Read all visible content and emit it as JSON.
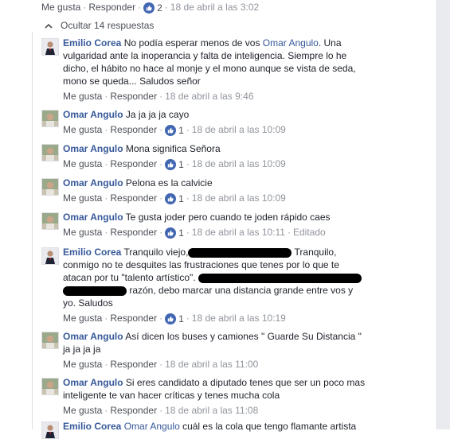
{
  "top_actions": {
    "like": "Me gusta",
    "reply": "Responder",
    "likes": "2",
    "time": "18 de abril a las 3:02"
  },
  "toggle": {
    "label": "Ocultar 14 respuestas"
  },
  "colors": {
    "link": "#365899",
    "like_badge": "#4267b2",
    "meta": "#90949c"
  },
  "comments": [
    {
      "avatar": "emilio-avatar",
      "author": "Emilio Corea",
      "segments": [
        {
          "type": "text",
          "value": " No podía esperar menos de vos "
        },
        {
          "type": "mention",
          "value": "Omar Angulo"
        },
        {
          "type": "text",
          "value": ". Una vulgaridad ante la inoperancia y falta de inteligencia. Siempre lo he dicho, el hábito no hace al monje y el mono aunque se vista de seda, mono se queda... Saludos señor"
        }
      ],
      "like": "Me gusta",
      "reply": "Responder",
      "likes": null,
      "time": "18 de abril a las 9:46",
      "edited": null
    },
    {
      "avatar": "omar-avatar",
      "author": "Omar Angulo",
      "segments": [
        {
          "type": "text",
          "value": " Ja ja ja ja cayo"
        }
      ],
      "like": "Me gusta",
      "reply": "Responder",
      "likes": "1",
      "time": "18 de abril a las 10:09",
      "edited": null
    },
    {
      "avatar": "omar-avatar",
      "author": "Omar Angulo",
      "segments": [
        {
          "type": "text",
          "value": " Mona significa Señora"
        }
      ],
      "like": "Me gusta",
      "reply": "Responder",
      "likes": "1",
      "time": "18 de abril a las 10:09",
      "edited": null
    },
    {
      "avatar": "omar-avatar",
      "author": "Omar Angulo",
      "segments": [
        {
          "type": "text",
          "value": " Pelona es la calvicie"
        }
      ],
      "like": "Me gusta",
      "reply": "Responder",
      "likes": "1",
      "time": "18 de abril a las 10:09",
      "edited": null
    },
    {
      "avatar": "omar-avatar",
      "author": "Omar Angulo",
      "segments": [
        {
          "type": "text",
          "value": " Te gusta joder pero cuando te joden rápido caes"
        }
      ],
      "like": "Me gusta",
      "reply": "Responder",
      "likes": "1",
      "time": "18 de abril a las 10:11",
      "edited": "Editado"
    },
    {
      "avatar": "emilio-avatar",
      "author": "Emilio Corea",
      "segments": [
        {
          "type": "text",
          "value": " Tranquilo viejo,"
        },
        {
          "type": "redact",
          "value": "130"
        },
        {
          "type": "text",
          "value": " Tranquilo, conmigo no te desquites las frustraciones que tenes por lo que te atacan por tu \"talento artístico\". "
        },
        {
          "type": "redact",
          "value": "205"
        },
        {
          "type": "text",
          "value": " "
        },
        {
          "type": "redact",
          "value": "80"
        },
        {
          "type": "text",
          "value": " razón, debo marcar una distancia grande entre vos y yo. Saludos"
        }
      ],
      "like": "Me gusta",
      "reply": "Responder",
      "likes": "1",
      "time": "18 de abril a las 10:19",
      "edited": null
    },
    {
      "avatar": "omar-avatar",
      "author": "Omar Angulo",
      "segments": [
        {
          "type": "text",
          "value": " Así dicen los buses y camiones \" Guarde Su Distancia \" ja ja ja ja"
        }
      ],
      "like": "Me gusta",
      "reply": "Responder",
      "likes": null,
      "time": "18 de abril a las 11:00",
      "edited": null
    },
    {
      "avatar": "omar-avatar",
      "author": "Omar Angulo",
      "segments": [
        {
          "type": "text",
          "value": " Si eres candidato a diputado tenes que ser un poco mas inteligente te van hacer críticas y tenes mucha cola"
        }
      ],
      "like": "Me gusta",
      "reply": "Responder",
      "likes": null,
      "time": "18 de abril a las 11:08",
      "edited": null
    },
    {
      "avatar": "emilio-avatar",
      "author": "Emilio Corea",
      "segments": [
        {
          "type": "text",
          "value": " "
        },
        {
          "type": "mention",
          "value": "Omar Angulo"
        },
        {
          "type": "text",
          "value": " cuál es la cola que tengo flamante artista"
        }
      ],
      "like": null,
      "reply": null,
      "likes": null,
      "time": null,
      "edited": null
    }
  ]
}
